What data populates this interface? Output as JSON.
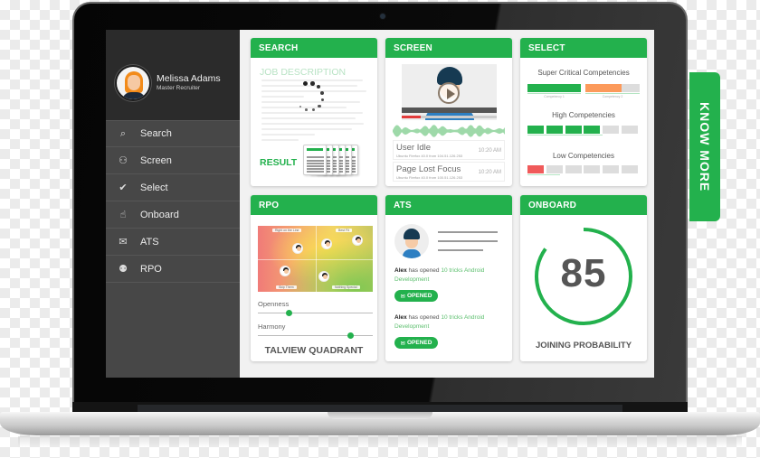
{
  "profile": {
    "name": "Melissa Adams",
    "role": "Master Recruiter"
  },
  "sidebar": {
    "items": [
      {
        "label": "Search",
        "icon": "search-icon",
        "glyph": "⌕"
      },
      {
        "label": "Screen",
        "icon": "screen-icon",
        "glyph": "⚇"
      },
      {
        "label": "Select",
        "icon": "check-icon",
        "glyph": "✔"
      },
      {
        "label": "Onboard",
        "icon": "thumbs-up-icon",
        "glyph": "☝"
      },
      {
        "label": "ATS",
        "icon": "mail-icon",
        "glyph": "✉"
      },
      {
        "label": "RPO",
        "icon": "team-icon",
        "glyph": "⚉"
      }
    ]
  },
  "cards": {
    "search": {
      "title": "SEARCH",
      "job_description_title": "JOB DESCRIPTION",
      "result_label": "RESULT",
      "resume_label": "RESUME"
    },
    "screen": {
      "title": "SCREEN",
      "video_progress": 0.2,
      "log": [
        {
          "title": "User Idle",
          "sub": "Ubuntu Firefox 40.0 from 104.51.126.253",
          "time": "10:20 AM"
        },
        {
          "title": "Page Lost Focus",
          "sub": "Ubuntu Firefox 40.0 from 100.51.126.253",
          "time": "10:20 AM"
        }
      ]
    },
    "select": {
      "title": "SELECT",
      "groups": [
        {
          "label": "Super Critical Competencies",
          "captions": [
            "Competency 1",
            "Competency 2"
          ]
        },
        {
          "label": "High Competencies",
          "filled": 4,
          "total": 6
        },
        {
          "label": "Low Competencies",
          "filled": 1,
          "total": 6
        }
      ]
    },
    "rpo": {
      "title": "RPO",
      "quadrants": [
        "Right on the Line",
        "Best Fit",
        "Skip Them",
        "Nothing Special"
      ],
      "sliders": [
        {
          "label": "Openness",
          "value": 0.27
        },
        {
          "label": "Harmony",
          "value": 0.81
        }
      ],
      "footer": "TALVIEW QUADRANT"
    },
    "ats": {
      "title": "ATS",
      "messages": [
        {
          "user": "Alex",
          "action": " has opened ",
          "link": "10 tricks Android Development",
          "badge": "OPENED"
        },
        {
          "user": "Alex",
          "action": " has opened ",
          "link": "10 tricks Android Development",
          "badge": "OPENED"
        }
      ]
    },
    "onboard": {
      "title": "ONBOARD",
      "score": "85",
      "score_fraction": 0.85,
      "label": "JOINING PROBABILITY"
    }
  },
  "cta": {
    "label": "KNOW MORE"
  },
  "colors": {
    "accent": "#23b14d",
    "orange": "#fc9a5b",
    "red": "#f05a5a",
    "sidebar": "#474747"
  }
}
